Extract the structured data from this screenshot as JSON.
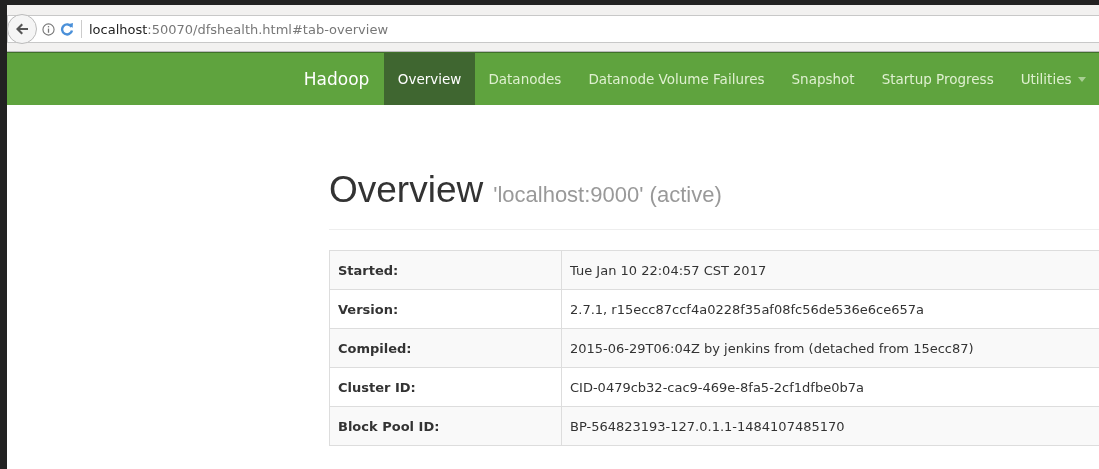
{
  "address_bar": {
    "host": "localhost",
    "path": ":50070/dfshealth.html#tab-overview"
  },
  "navbar": {
    "brand": "Hadoop",
    "items": [
      {
        "label": "Overview",
        "selected": true,
        "kind": "link"
      },
      {
        "label": "Datanodes",
        "selected": false,
        "kind": "link"
      },
      {
        "label": "Datanode Volume Failures",
        "selected": false,
        "kind": "link"
      },
      {
        "label": "Snapshot",
        "selected": false,
        "kind": "link"
      },
      {
        "label": "Startup Progress",
        "selected": false,
        "kind": "link"
      },
      {
        "label": "Utilities",
        "selected": false,
        "kind": "dropdown"
      }
    ]
  },
  "page": {
    "title": "Overview",
    "subtitle": "'localhost:9000' (active)"
  },
  "table": {
    "rows": [
      {
        "label": "Started:",
        "value": "Tue Jan 10 22:04:57 CST 2017"
      },
      {
        "label": "Version:",
        "value": "2.7.1, r15ecc87ccf4a0228f35af08fc56de536e6ce657a"
      },
      {
        "label": "Compiled:",
        "value": "2015-06-29T06:04Z by jenkins from (detached from 15ecc87)"
      },
      {
        "label": "Cluster ID:",
        "value": "CID-0479cb32-cac9-469e-8fa5-2cf1dfbe0b7a"
      },
      {
        "label": "Block Pool ID:",
        "value": "BP-564823193-127.0.1.1-1484107485170"
      }
    ]
  }
}
